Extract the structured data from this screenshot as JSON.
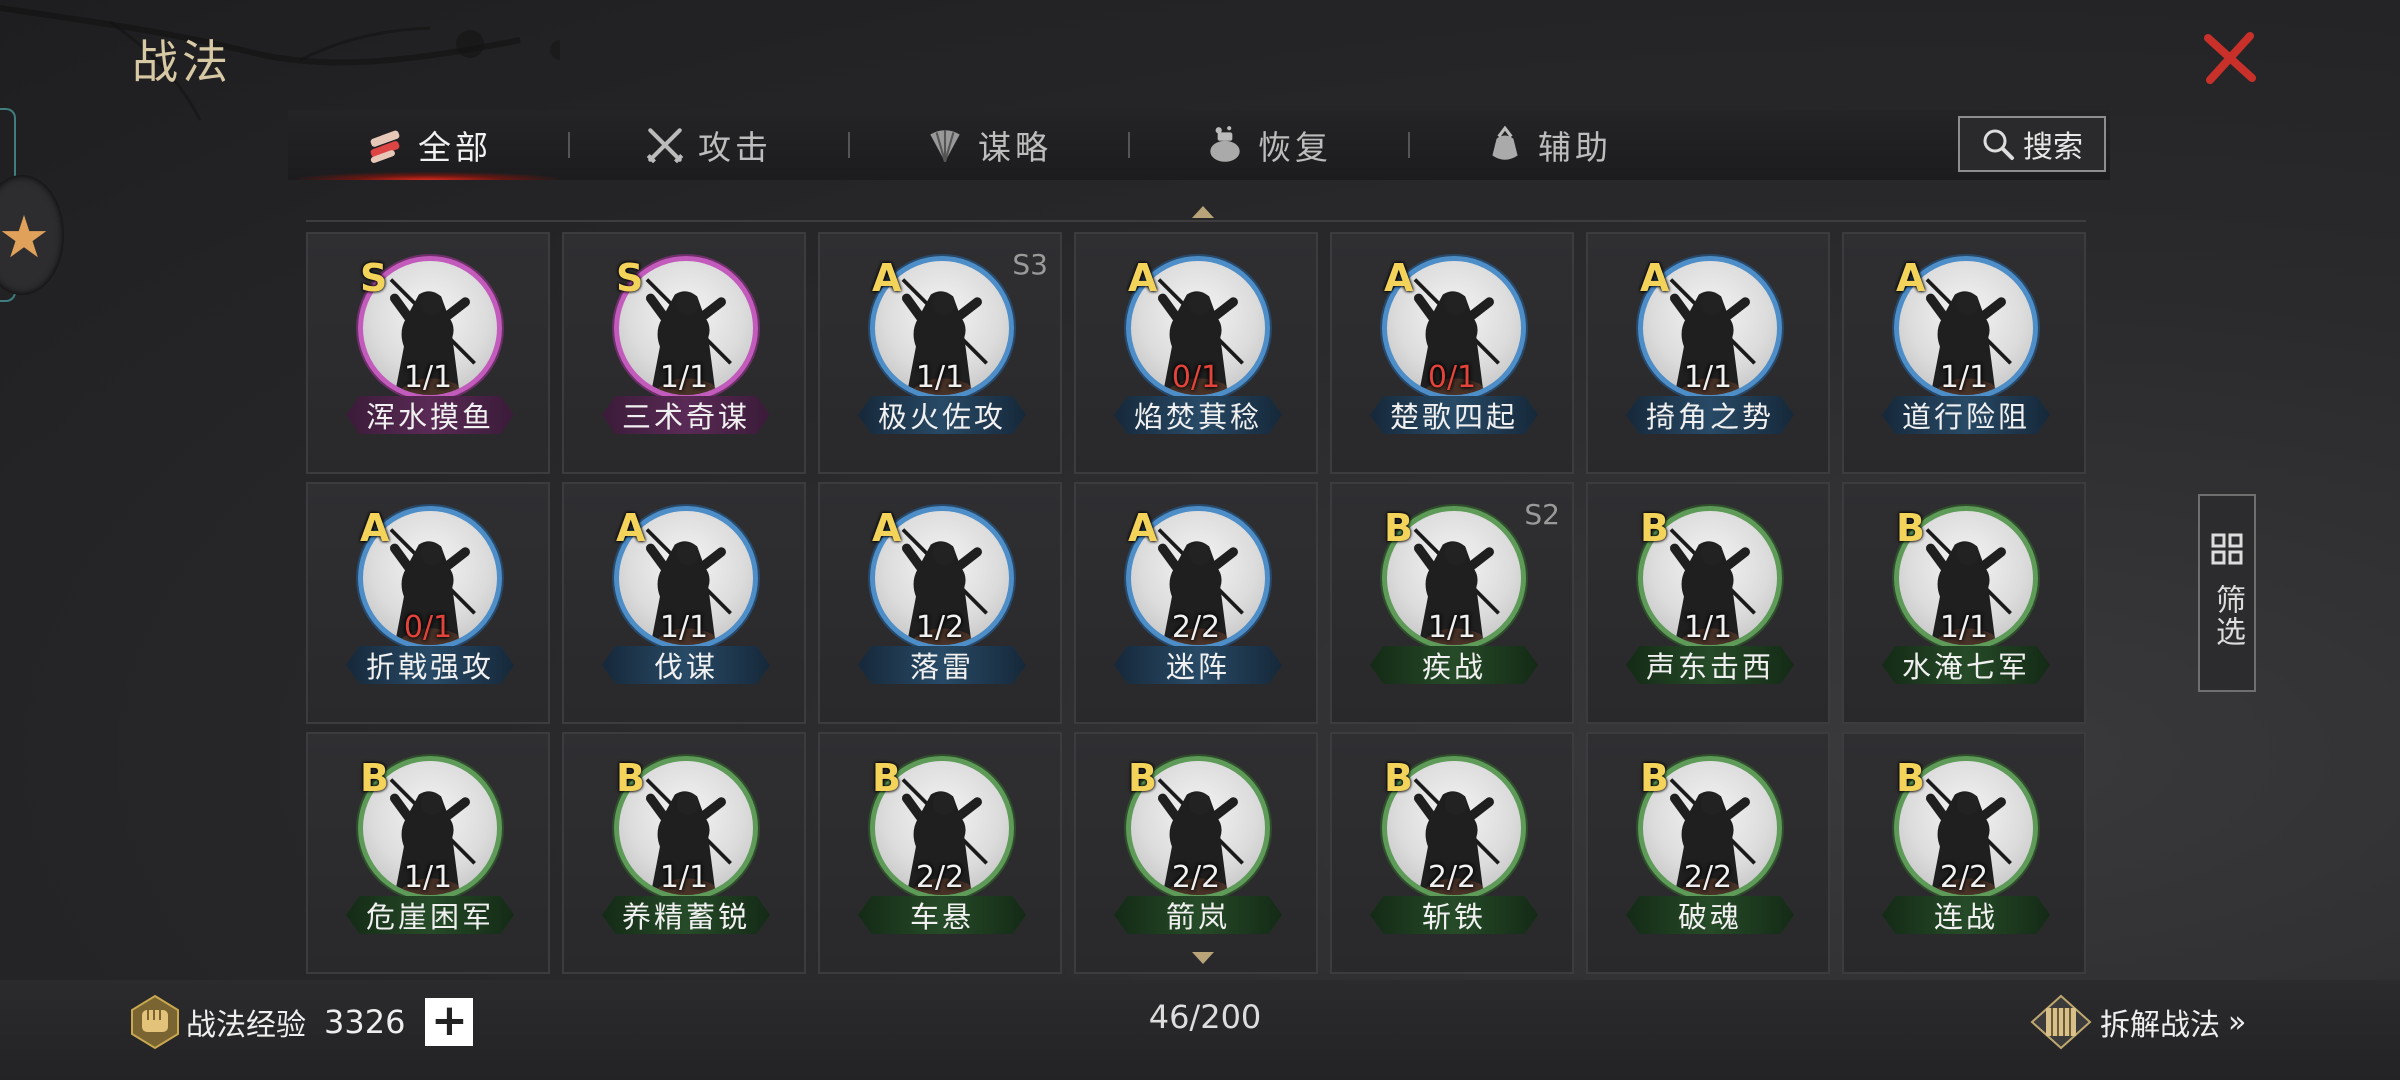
{
  "page": {
    "title": "战法"
  },
  "tabs": [
    {
      "label": "全部",
      "icon": "scroll-bundle-icon",
      "active": true
    },
    {
      "label": "攻击",
      "icon": "crossed-swords-icon",
      "active": false
    },
    {
      "label": "谋略",
      "icon": "feather-fan-icon",
      "active": false
    },
    {
      "label": "恢复",
      "icon": "potion-pot-icon",
      "active": false
    },
    {
      "label": "辅助",
      "icon": "pouch-icon",
      "active": false
    }
  ],
  "search": {
    "label": "搜索",
    "icon": "search-icon"
  },
  "filter": {
    "label": "筛选",
    "icon": "grid-icon"
  },
  "colors": {
    "S": "#c35bbc",
    "A": "#4d8ec8",
    "B": "#5e9b58",
    "zero_count": "#e2433a",
    "tab_active_glow": "#d62a1d"
  },
  "cards": [
    {
      "grade": "S",
      "count": "1/1",
      "name": "浑水摸鱼",
      "season": ""
    },
    {
      "grade": "S",
      "count": "1/1",
      "name": "三术奇谋",
      "season": ""
    },
    {
      "grade": "A",
      "count": "1/1",
      "name": "极火佐攻",
      "season": "S3"
    },
    {
      "grade": "A",
      "count": "0/1",
      "name": "焰焚萁稔",
      "season": ""
    },
    {
      "grade": "A",
      "count": "0/1",
      "name": "楚歌四起",
      "season": ""
    },
    {
      "grade": "A",
      "count": "1/1",
      "name": "掎角之势",
      "season": ""
    },
    {
      "grade": "A",
      "count": "1/1",
      "name": "道行险阻",
      "season": ""
    },
    {
      "grade": "A",
      "count": "0/1",
      "name": "折戟强攻",
      "season": ""
    },
    {
      "grade": "A",
      "count": "1/1",
      "name": "伐谋",
      "season": ""
    },
    {
      "grade": "A",
      "count": "1/2",
      "name": "落雷",
      "season": ""
    },
    {
      "grade": "A",
      "count": "2/2",
      "name": "迷阵",
      "season": ""
    },
    {
      "grade": "B",
      "count": "1/1",
      "name": "疾战",
      "season": "S2"
    },
    {
      "grade": "B",
      "count": "1/1",
      "name": "声东击西",
      "season": ""
    },
    {
      "grade": "B",
      "count": "1/1",
      "name": "水淹七军",
      "season": ""
    },
    {
      "grade": "B",
      "count": "1/1",
      "name": "危崖困军",
      "season": ""
    },
    {
      "grade": "B",
      "count": "1/1",
      "name": "养精蓄锐",
      "season": ""
    },
    {
      "grade": "B",
      "count": "2/2",
      "name": "车悬",
      "season": ""
    },
    {
      "grade": "B",
      "count": "2/2",
      "name": "箭岚",
      "season": ""
    },
    {
      "grade": "B",
      "count": "2/2",
      "name": "斩铁",
      "season": ""
    },
    {
      "grade": "B",
      "count": "2/2",
      "name": "破魂",
      "season": ""
    },
    {
      "grade": "B",
      "count": "2/2",
      "name": "连战",
      "season": ""
    }
  ],
  "footer": {
    "exp_label": "战法经验",
    "exp_value": "3326",
    "plus": "+",
    "capacity": "46/200",
    "dismantle_label": "拆解战法",
    "dismantle_arrow": "»"
  }
}
